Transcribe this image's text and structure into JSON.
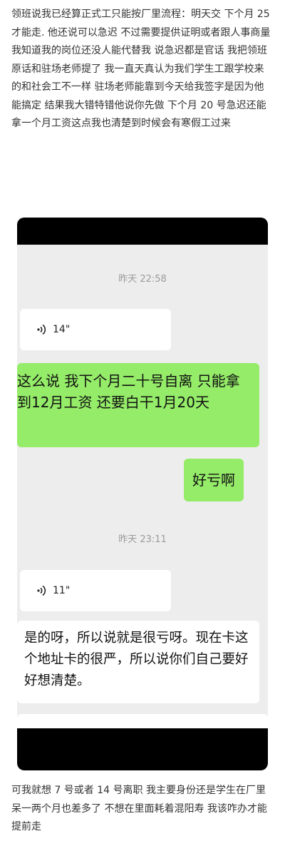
{
  "post": {
    "intro": "领班说我已经算正式工只能按厂里流程：明天交 下个月 25 才能走. 他还说可以急迟 不过需要提供证明或者跟人事商量 我知道我的岗位还没人能代替我 说急迟都是官话 我把领班原话和驻场老师提了 我一直天真认为我们学生工跟学校来的和社会工不一样 驻场老师能靠到今天给我签字是因为他能搞定 结果我大错特错他说你先做 下个月 20 号急迟还能拿一个月工资这点我也清楚到时候会有寒假工过来",
    "outro": "可我就想 7 号或者 14 号离职 我主要身份还是学生在厂里呆一两个月也差多了 不想在里面耗着混阳寿 我该咋办才能提前走"
  },
  "chat": {
    "timestamp1": "昨天 22:58",
    "voice1_duration": "14\"",
    "sent_message_1": "这么说 我下个月二十号自离 只能拿到12月工资 还要白干1月20天",
    "sent_message_2": "好亏啊",
    "timestamp2": "昨天 23:11",
    "voice2_duration": "11\"",
    "received_message": "是的呀，所以说就是很亏呀。现在卡这个地址卡的很严，所以说你们自己要好好想清楚。",
    "colors": {
      "chat_background": "#ededed",
      "sent_bubble": "#95ec69",
      "received_bubble": "#ffffff",
      "redaction_bar": "#000000"
    },
    "icons": {
      "voice": "voice-wave-icon"
    }
  }
}
